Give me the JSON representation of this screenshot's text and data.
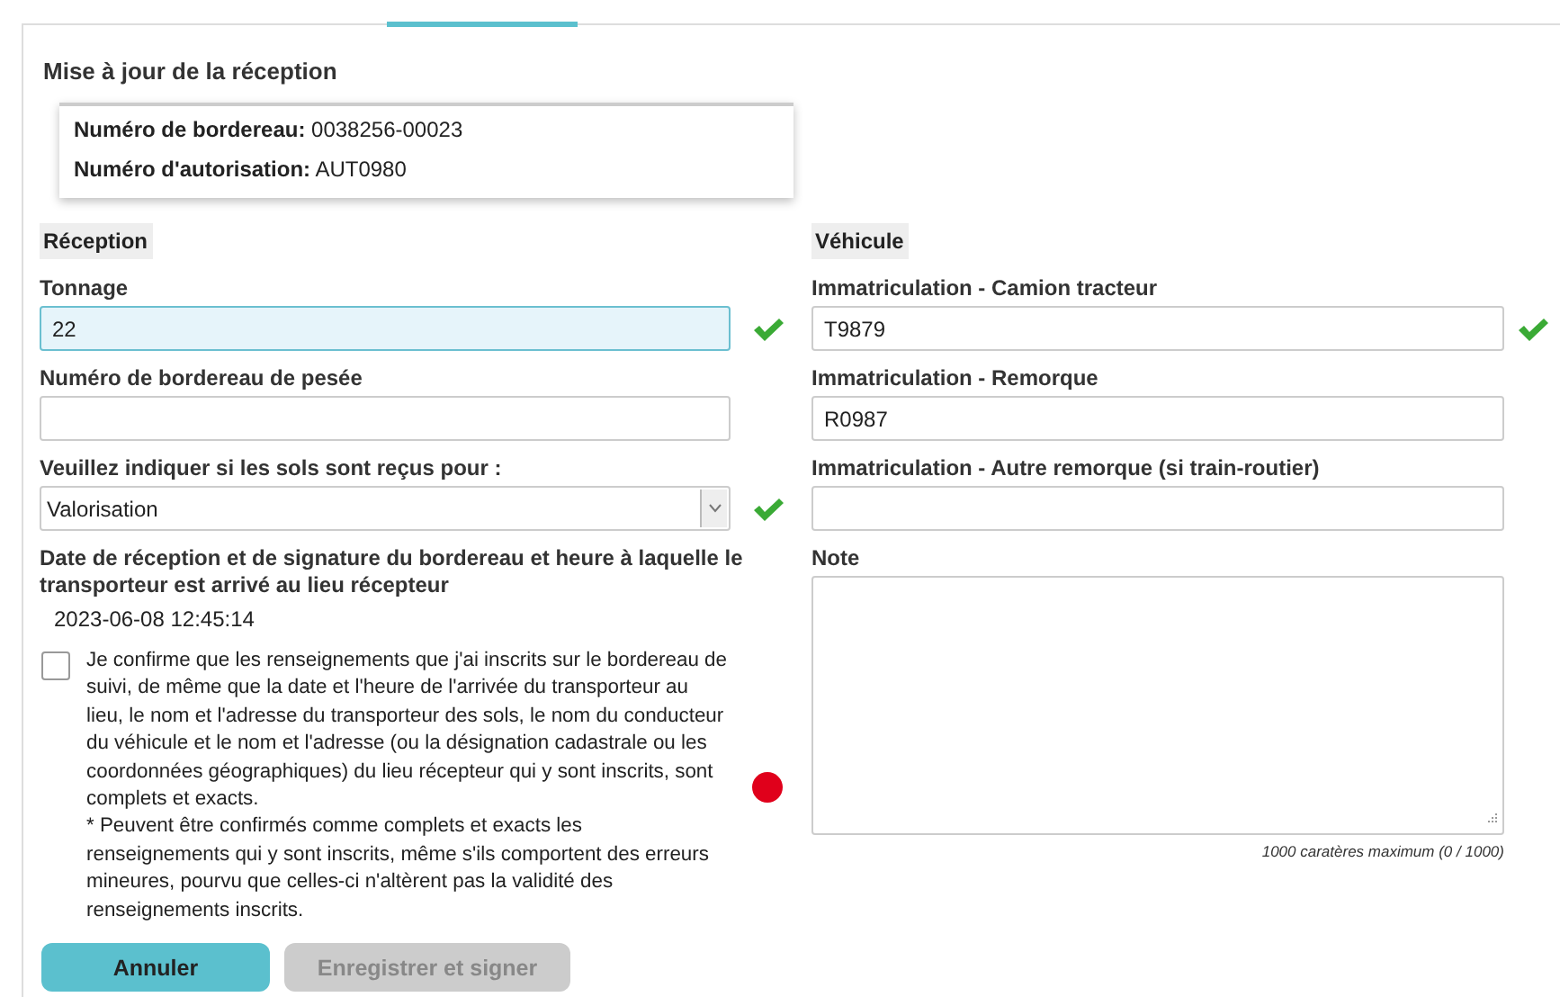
{
  "title": "Mise à jour de la réception",
  "info": [
    "**Numéro de bordereau:** 0038256-00023",
    "**Numéro d'autorisation:** AUT0980"
  ],
  "reception": {
    "heading": "Réception",
    "fields": [
      {
        "kind": "input",
        "label": "Tonnage",
        "value": "22",
        "focused": true,
        "valid": true
      },
      {
        "kind": "input",
        "label": "Numéro de bordereau de pesée",
        "focused": false,
        "valid": false
      },
      {
        "kind": "select",
        "label": "Veuillez indiquer si les sols sont reçus pour :",
        "value": "Valorisation",
        "valid": true
      },
      {
        "kind": "text",
        "label": "Date de réception et de signature du bordereau et heure à laquelle le transporteur est arrivé au lieu récepteur",
        "value": "2023-06-08 12:45:14",
        "valid": false
      }
    ],
    "confirmation": {
      "checked": false,
      "text": "Je confirme que les renseignements que j'ai inscrits sur le bordereau de suivi, de même que la date et l'heure de l'arrivée du transporteur au lieu, le nom et l'adresse du transporteur des sols, le nom du conducteur du véhicule et le nom et l'adresse (ou la désignation cadastrale ou les coordonnées géographiques) du lieu récepteur qui y sont inscrits, sont complets et exacts.",
      "footnote": "* Peuvent être confirmés comme complets et exacts les renseignements qui y sont inscrits, même s'ils comportent des erreurs mineures, pourvu que celles-ci n'altèrent pas la validité des renseignements inscrits.",
      "error": true
    }
  },
  "vehicle": {
    "heading": "Véhicule",
    "fields": [
      {
        "kind": "input",
        "label": "Immatriculation - Camion tracteur",
        "value": "T9879",
        "focused": false,
        "valid": true
      },
      {
        "kind": "input",
        "label": "Immatriculation - Remorque",
        "value": "R0987",
        "focused": false,
        "valid": false
      },
      {
        "kind": "input",
        "label": "Immatriculation - Autre remorque (si train-routier)",
        "focused": false,
        "valid": false
      },
      {
        "kind": "textarea",
        "label": "Note",
        "counter": "1000 caratères maximum (0 / 1000)",
        "valid": false
      }
    ]
  },
  "buttons": [
    {
      "label": "Annuler",
      "disabled": false
    },
    {
      "label": "Enregistrer et signer",
      "disabled": true
    }
  ]
}
